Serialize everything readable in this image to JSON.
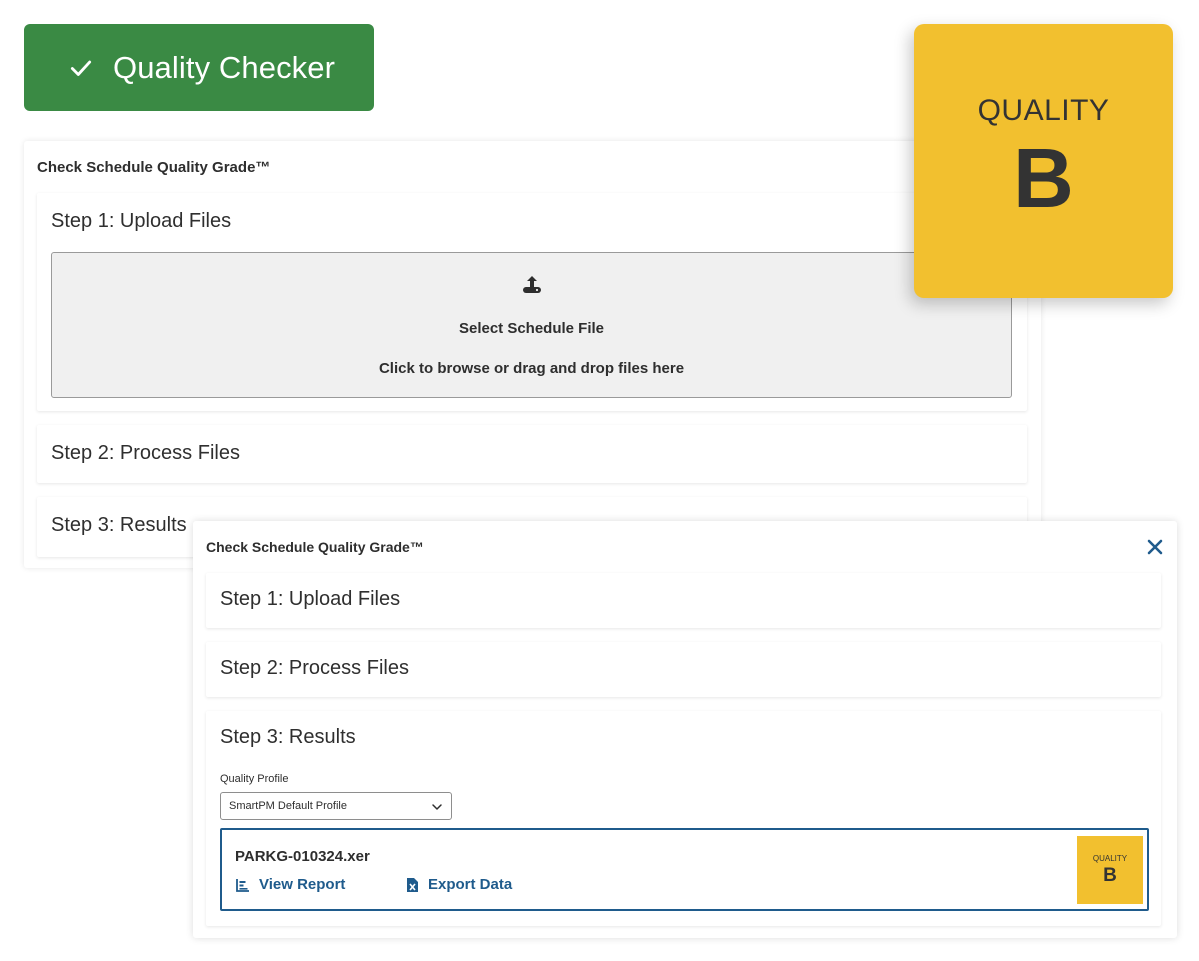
{
  "badge": {
    "label": "Quality Checker",
    "icon": "check-icon",
    "color": "#3a8a44"
  },
  "back_panel": {
    "title": "Check Schedule Quality Grade™",
    "step1": {
      "title": "Step 1: Upload Files",
      "dropzone": {
        "icon": "upload-icon",
        "title": "Select Schedule File",
        "subtitle": "Click to browse or drag and drop files here"
      }
    },
    "step2": {
      "title": "Step 2: Process Files"
    },
    "step3": {
      "title": "Step 3: Results"
    }
  },
  "grade_card": {
    "label": "QUALITY",
    "letter": "B",
    "color": "#f2c02f"
  },
  "front_panel": {
    "title": "Check Schedule Quality Grade™",
    "close_icon": "close-icon",
    "step1": {
      "title": "Step 1: Upload Files"
    },
    "step2": {
      "title": "Step 2: Process Files"
    },
    "step3": {
      "title": "Step 3: Results",
      "profile_label": "Quality Profile",
      "profile_selected": "SmartPM Default Profile",
      "result": {
        "file_name": "PARKG-010324.xer",
        "view_report": "View Report",
        "export_data": "Export Data",
        "grade_label": "QUALITY",
        "grade_letter": "B"
      }
    }
  },
  "colors": {
    "link": "#1f5b8c",
    "accent_yellow": "#f2c02f",
    "green": "#3a8a44"
  }
}
